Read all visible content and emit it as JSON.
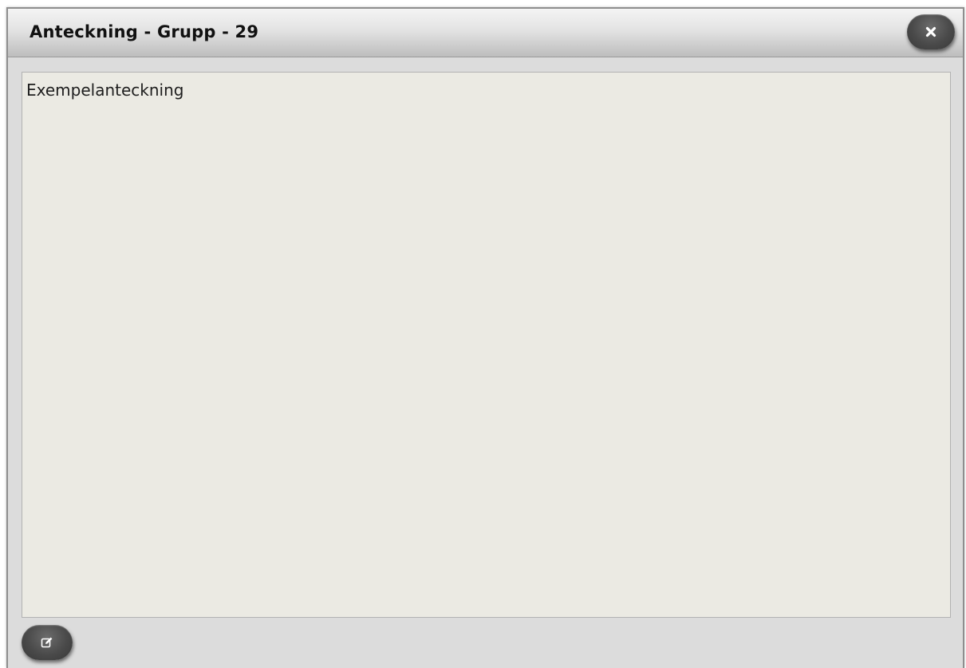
{
  "dialog": {
    "title": "Anteckning - Grupp - 29",
    "close_icon": "close-icon",
    "note": {
      "text": "Exempelanteckning"
    },
    "edit_icon": "edit-icon"
  },
  "colors": {
    "note_background": "#ebeae3",
    "dialog_background": "#dcdcdc",
    "button_background": "#4a4a4a",
    "icon_color": "#ffffff"
  }
}
